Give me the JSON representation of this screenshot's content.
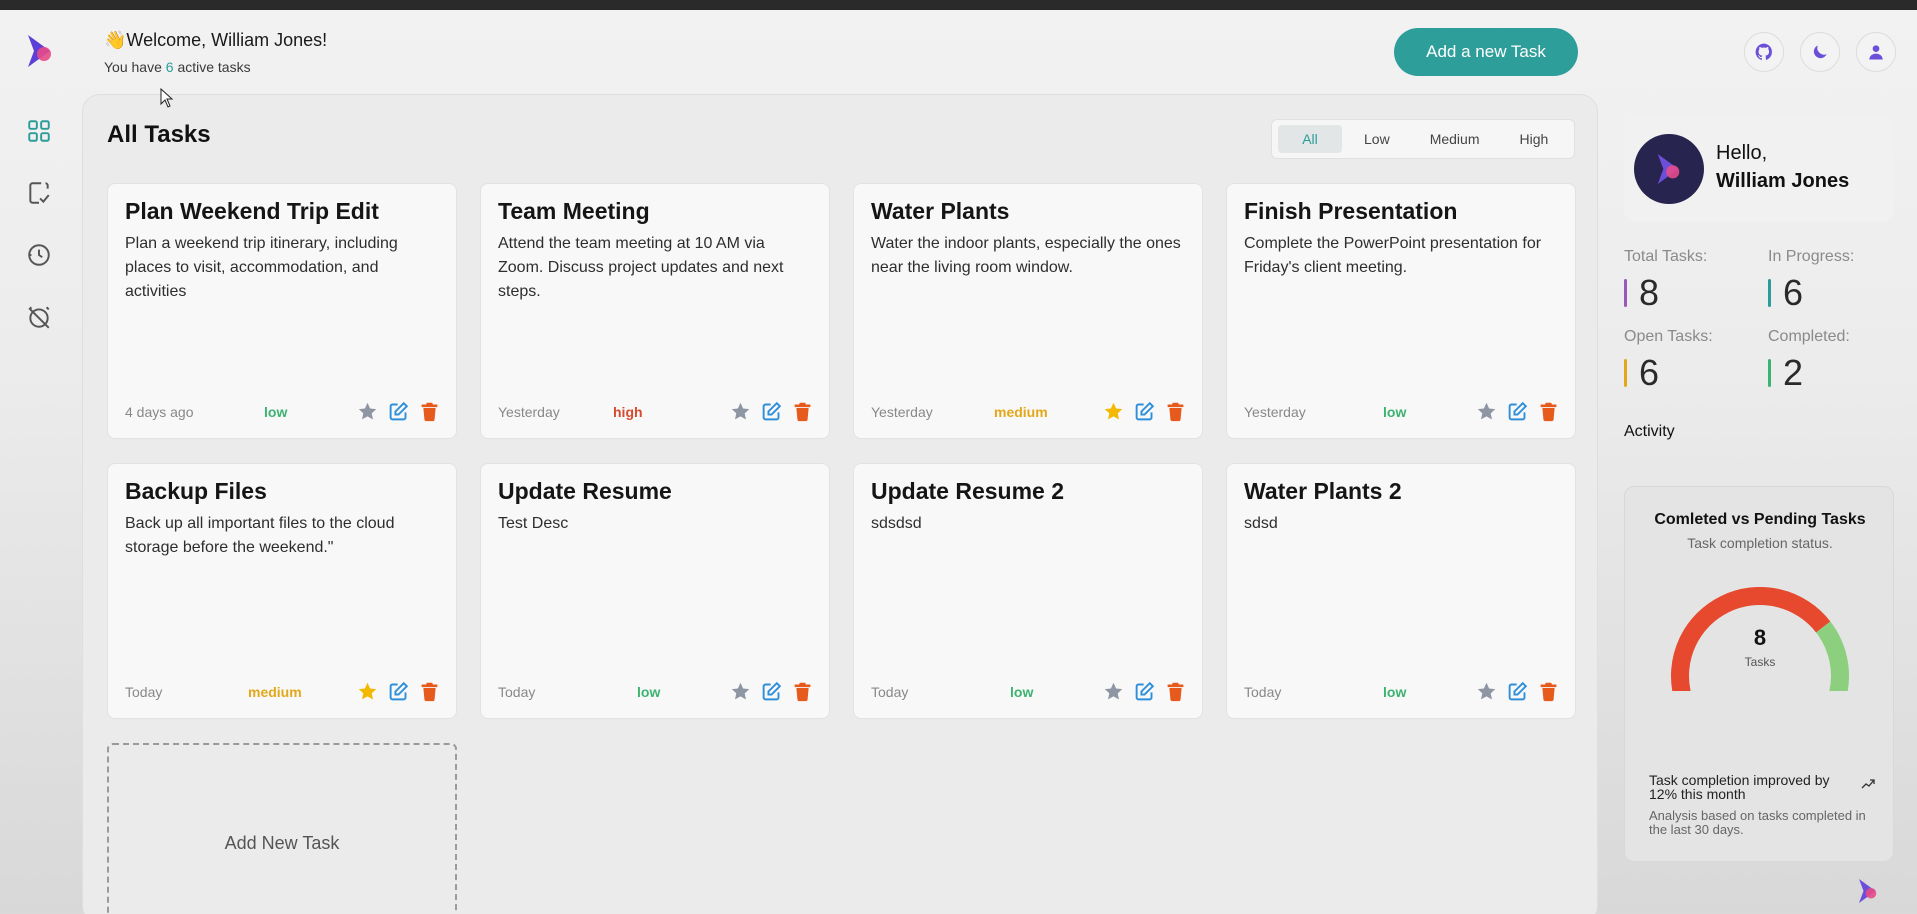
{
  "header": {
    "wave": "👋",
    "welcome": "Welcome, William Jones!",
    "active_prefix": "You have ",
    "active_count": "6",
    "active_suffix": " active tasks",
    "add_task_label": "Add a new Task"
  },
  "sidebar_icons": [
    "grid-icon",
    "checklist-icon",
    "clock-icon",
    "alarm-off-icon"
  ],
  "main": {
    "title": "All Tasks",
    "filters": [
      "All",
      "Low",
      "Medium",
      "High"
    ],
    "active_filter": "All",
    "add_new_label": "Add New Task",
    "tasks": [
      {
        "title": "Plan Weekend Trip Edit",
        "desc": "Plan a weekend trip itinerary, including places to visit, accommodation, and activities",
        "date": "4 days ago",
        "priority": "low",
        "starred": false
      },
      {
        "title": "Team Meeting",
        "desc": "Attend the team meeting at 10 AM via Zoom. Discuss project updates and next steps.",
        "date": "Yesterday",
        "priority": "high",
        "starred": false
      },
      {
        "title": "Water Plants",
        "desc": "Water the indoor plants, especially the ones near the living room window.",
        "date": "Yesterday",
        "priority": "medium",
        "starred": true
      },
      {
        "title": "Finish Presentation",
        "desc": "Complete the PowerPoint presentation for Friday's client meeting.",
        "date": "Yesterday",
        "priority": "low",
        "starred": false
      },
      {
        "title": "Backup Files",
        "desc": "Back up all important files to the cloud storage before the weekend.\"",
        "date": "Today",
        "priority": "medium",
        "starred": true
      },
      {
        "title": "Update Resume",
        "desc": "Test Desc",
        "date": "Today",
        "priority": "low",
        "starred": false
      },
      {
        "title": "Update Resume 2",
        "desc": "sdsdsd",
        "date": "Today",
        "priority": "low",
        "starred": false
      },
      {
        "title": "Water Plants 2",
        "desc": "sdsd",
        "date": "Today",
        "priority": "low",
        "starred": false
      }
    ]
  },
  "profile": {
    "hello": "Hello,",
    "name": "William Jones"
  },
  "stats": {
    "total_label": "Total Tasks:",
    "total_value": "8",
    "total_color": "#9b59b6",
    "progress_label": "In Progress:",
    "progress_value": "6",
    "progress_color": "#2a9d9a",
    "open_label": "Open Tasks:",
    "open_value": "6",
    "open_color": "#e3a81a",
    "completed_label": "Completed:",
    "completed_value": "2",
    "completed_color": "#3cb371"
  },
  "activity": {
    "label": "Activity",
    "chart_title": "Comleted vs Pending Tasks",
    "chart_subtitle": "Task completion status.",
    "total": "8",
    "unit": "Tasks",
    "footer": "Task completion improved by 12% this month",
    "note": "Analysis based on tasks completed in the last 30 days."
  },
  "chart_data": {
    "type": "pie",
    "title": "Comleted vs Pending Tasks",
    "subtitle": "Task completion status.",
    "categories": [
      "Pending",
      "Completed"
    ],
    "values": [
      6,
      2
    ],
    "colors": [
      "#e6492d",
      "#8ccf7e"
    ],
    "center_value": 8,
    "center_label": "Tasks"
  },
  "colors": {
    "accent": "#2e9e9b",
    "brand_purple": "#5b3fd6",
    "brand_pink": "#e64a8b",
    "star_active": "#f5b800",
    "star_inactive": "#8f96a3",
    "edit": "#2d8fd9",
    "delete": "#e65a1e"
  }
}
